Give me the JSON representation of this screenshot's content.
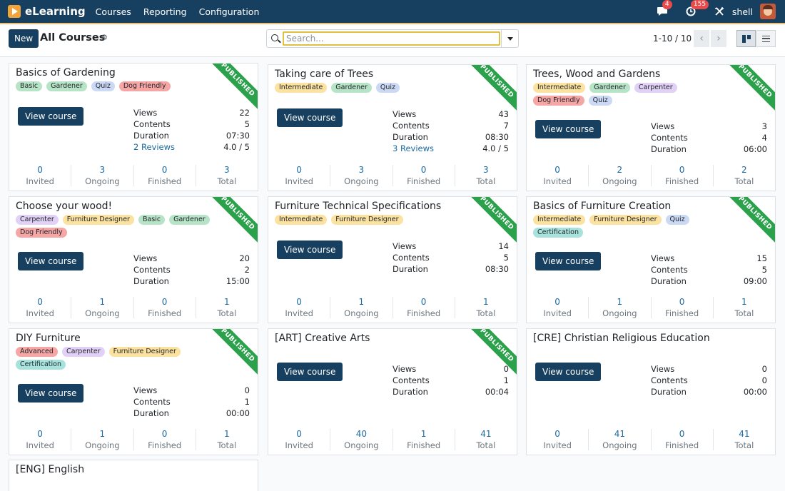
{
  "navbar": {
    "app_name": "eLearning",
    "menu": [
      "Courses",
      "Reporting",
      "Configuration"
    ],
    "chat_badge": "4",
    "activity_badge": "155",
    "user_name": "shell",
    "brand_color": "#173f5f"
  },
  "control": {
    "new_label": "New",
    "title": "All Courses",
    "search_placeholder": "Search...",
    "pager": "1-10 / 10"
  },
  "tag_colors": {
    "Basic": "#b7e4c7",
    "Gardener": "#b7e4c7",
    "Quiz": "#cbd9f5",
    "Dog Friendly": "#f7a6a6",
    "Intermediate": "#fce2a0",
    "Carpenter": "#e2d1f7",
    "Furniture Designer": "#fce2a0",
    "Certification": "#a7e3dc",
    "Advanced": "#f7a6a6"
  },
  "counter_labels": [
    "Invited",
    "Ongoing",
    "Finished",
    "Total"
  ],
  "stat_labels": {
    "views": "Views",
    "contents": "Contents",
    "duration": "Duration"
  },
  "view_course_label": "View course",
  "ribbon_label": "PUBLISHED",
  "courses": [
    {
      "title": "Basics of Gardening",
      "tags": [
        "Basic",
        "Gardener",
        "Quiz",
        "Dog Friendly"
      ],
      "published": true,
      "views": "22",
      "contents": "5",
      "duration": "07:30",
      "reviews": "2 Reviews",
      "rating": "4.0 / 5",
      "counters": [
        "0",
        "3",
        "0",
        "3"
      ]
    },
    {
      "title": "Taking care of Trees",
      "tags": [
        "Intermediate",
        "Gardener",
        "Quiz"
      ],
      "published": true,
      "views": "43",
      "contents": "7",
      "duration": "08:30",
      "reviews": "3 Reviews",
      "rating": "4.0 / 5",
      "counters": [
        "0",
        "3",
        "0",
        "3"
      ]
    },
    {
      "title": "Trees, Wood and Gardens",
      "tags": [
        "Intermediate",
        "Gardener",
        "Carpenter",
        "Dog Friendly",
        "Quiz"
      ],
      "published": true,
      "views": "3",
      "contents": "4",
      "duration": "06:00",
      "reviews": "",
      "rating": "",
      "counters": [
        "0",
        "2",
        "0",
        "2"
      ]
    },
    {
      "title": "Choose your wood!",
      "tags": [
        "Carpenter",
        "Furniture Designer",
        "Basic",
        "Gardener",
        "Dog Friendly"
      ],
      "published": true,
      "views": "20",
      "contents": "2",
      "duration": "15:00",
      "reviews": "",
      "rating": "",
      "counters": [
        "0",
        "1",
        "0",
        "1"
      ]
    },
    {
      "title": "Furniture Technical Specifications",
      "tags": [
        "Intermediate",
        "Furniture Designer"
      ],
      "published": true,
      "views": "14",
      "contents": "5",
      "duration": "08:30",
      "reviews": "",
      "rating": "",
      "counters": [
        "0",
        "1",
        "0",
        "1"
      ]
    },
    {
      "title": "Basics of Furniture Creation",
      "tags": [
        "Intermediate",
        "Furniture Designer",
        "Quiz",
        "Certification"
      ],
      "published": true,
      "views": "15",
      "contents": "5",
      "duration": "09:00",
      "reviews": "",
      "rating": "",
      "counters": [
        "0",
        "1",
        "0",
        "1"
      ]
    },
    {
      "title": "DIY Furniture",
      "tags": [
        "Advanced",
        "Carpenter",
        "Furniture Designer",
        "Certification"
      ],
      "published": true,
      "views": "0",
      "contents": "1",
      "duration": "00:00",
      "reviews": "",
      "rating": "",
      "counters": [
        "0",
        "1",
        "0",
        "1"
      ]
    },
    {
      "title": "[ART] Creative Arts",
      "tags": [],
      "published": true,
      "views": "0",
      "contents": "1",
      "duration": "00:04",
      "reviews": "",
      "rating": "",
      "counters": [
        "0",
        "40",
        "1",
        "41"
      ]
    },
    {
      "title": "[CRE] Christian Religious Education",
      "tags": [],
      "published": false,
      "views": "0",
      "contents": "0",
      "duration": "00:00",
      "reviews": "",
      "rating": "",
      "counters": [
        "0",
        "41",
        "0",
        "41"
      ]
    },
    {
      "title": "[ENG] English",
      "tags": [],
      "published": false,
      "views": "",
      "contents": "",
      "duration": "",
      "reviews": "",
      "rating": "",
      "counters": []
    }
  ]
}
